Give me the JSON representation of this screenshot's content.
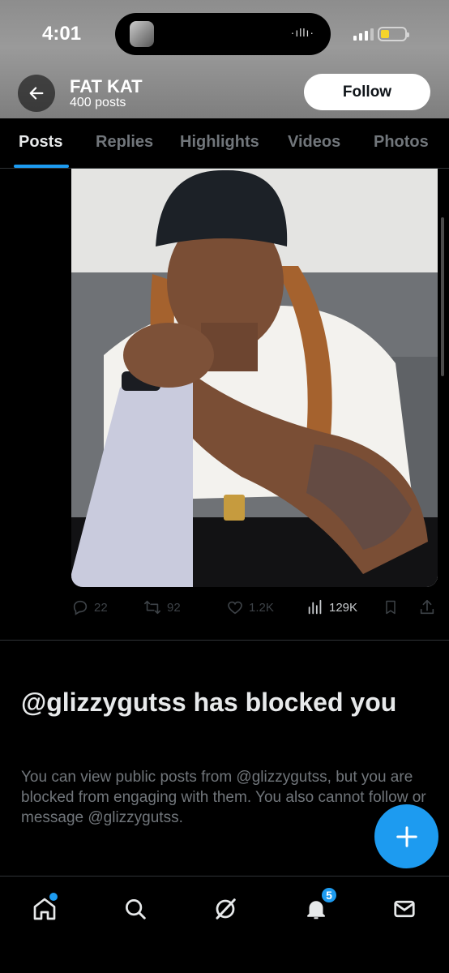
{
  "status_bar": {
    "time": "4:01",
    "battery_level": 0.34
  },
  "header": {
    "profile_name": "FAT KAT",
    "post_count": "400 posts",
    "follow_label": "Follow",
    "back_icon": "arrow-left-icon"
  },
  "tabs": [
    {
      "label": "Posts",
      "active": true
    },
    {
      "label": "Replies",
      "active": false
    },
    {
      "label": "Highlights",
      "active": false
    },
    {
      "label": "Videos",
      "active": false
    },
    {
      "label": "Photos",
      "active": false
    }
  ],
  "post": {
    "replies": "22",
    "reposts": "92",
    "likes": "1.2K",
    "views": "129K"
  },
  "blocked": {
    "title": "@glizzygutss has blocked you",
    "message": "You can view public posts from @glizzygutss, but you are blocked from engaging with them. You also cannot follow or message @glizzygutss."
  },
  "bottom_nav": {
    "notifications_badge": "5",
    "items": [
      "home-icon",
      "search-icon",
      "grok-icon",
      "bell-icon",
      "mail-icon"
    ]
  },
  "colors": {
    "accent": "#1d9bf0",
    "background": "#000000",
    "muted_text": "#71767b"
  }
}
